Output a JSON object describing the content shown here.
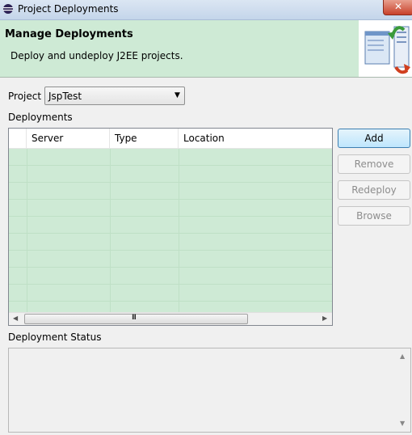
{
  "window": {
    "title": "Project Deployments",
    "close_label": "✕"
  },
  "banner": {
    "heading": "Manage Deployments",
    "description": "Deploy and undeploy J2EE projects."
  },
  "project": {
    "label": "Project",
    "selected": "JspTest"
  },
  "deployments": {
    "label": "Deployments",
    "columns": [
      "Server",
      "Type",
      "Location"
    ],
    "rows": []
  },
  "buttons": {
    "add": "Add",
    "remove": "Remove",
    "redeploy": "Redeploy",
    "browse": "Browse"
  },
  "status": {
    "label": "Deployment Status",
    "text": ""
  },
  "scrollbar": {
    "grip": "III"
  },
  "colors": {
    "banner_bg": "#ceead5",
    "table_bg": "#ceead5"
  }
}
